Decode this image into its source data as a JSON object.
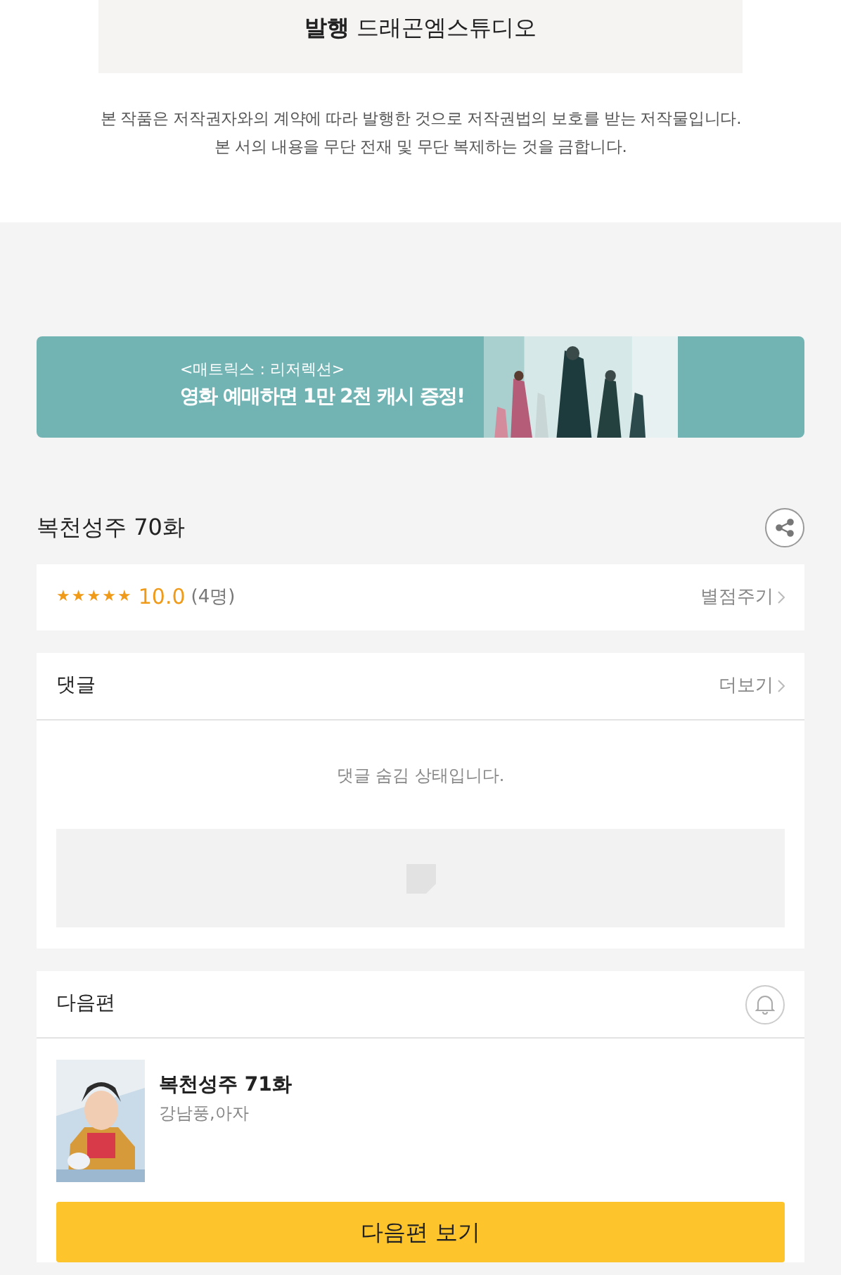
{
  "publisher": {
    "label": "발행",
    "value": "드래곤엠스튜디오"
  },
  "copyright_notice": [
    "본 작품은 저작권자와의 계약에 따라 발행한 것으로 저작권법의 보호를 받는 저작물입니다.",
    "본 서의 내용을 무단 전재 및 무단 복제하는 것을 금합니다."
  ],
  "banner": {
    "subtitle": "<매트릭스 : 리저렉션>",
    "headline": "영화 예매하면 1만 2천 캐시 증정!"
  },
  "episode_title": "복천성주 70화",
  "rating": {
    "stars": 5,
    "score": "10.0",
    "count": "(4명)",
    "action": "별점주기"
  },
  "comments": {
    "title": "댓글",
    "more": "더보기",
    "message": "댓글 숨김 상태입니다."
  },
  "next_episode": {
    "section_title": "다음편",
    "title": "복천성주 71화",
    "authors": "강남풍,아자",
    "button": "다음편 보기"
  }
}
